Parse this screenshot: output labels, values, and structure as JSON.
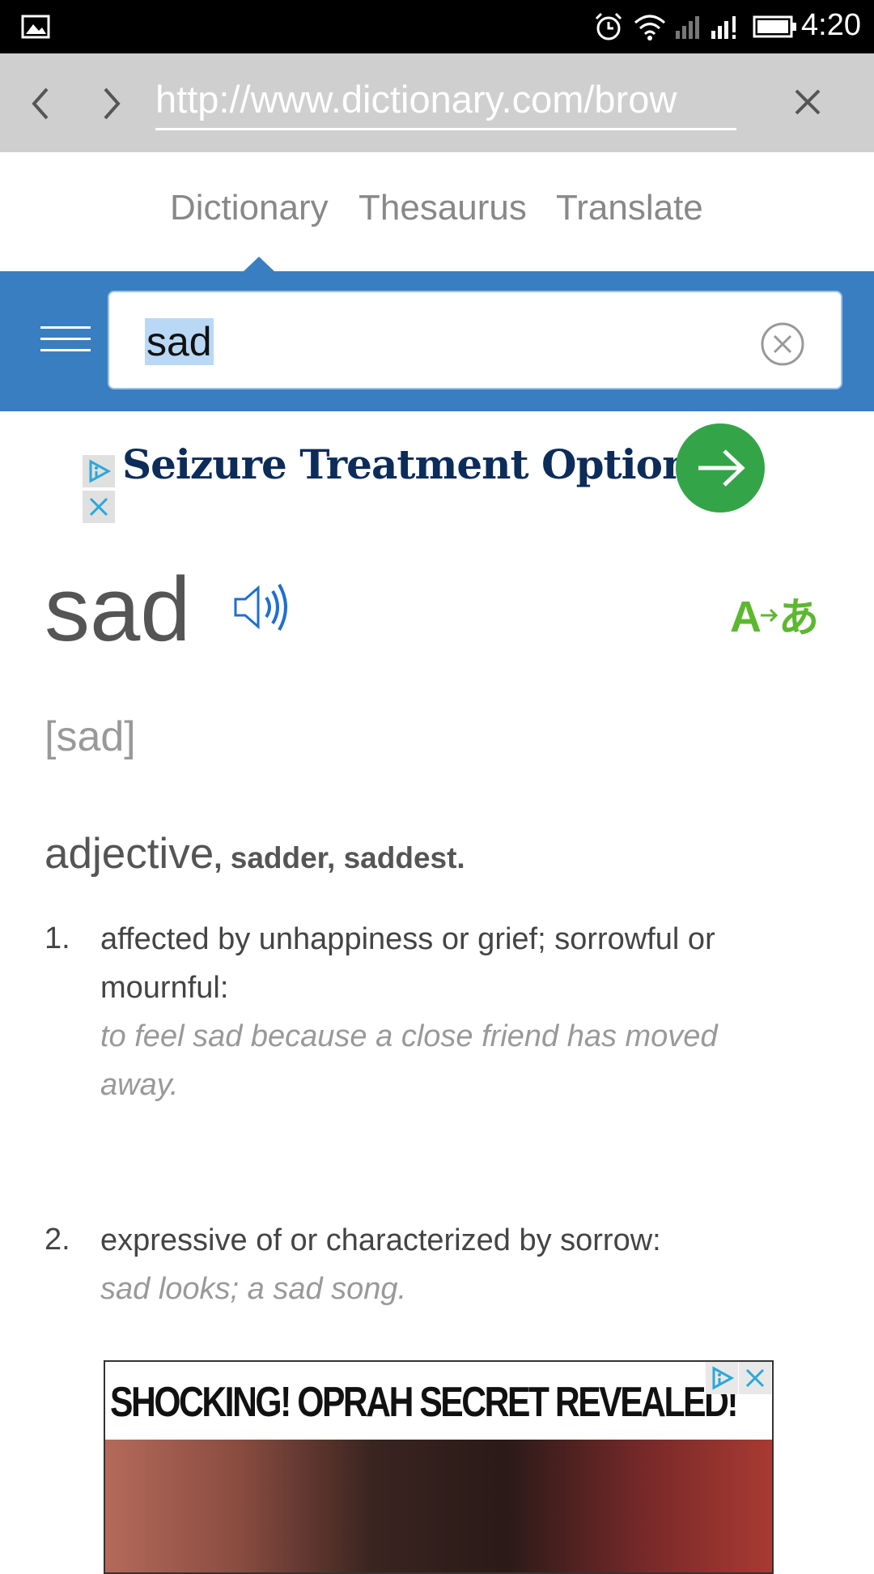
{
  "status_bar": {
    "time": "4:20",
    "icons": [
      "image-icon",
      "alarm-icon",
      "wifi-icon",
      "signal-icon",
      "signal-icon",
      "battery-icon"
    ]
  },
  "browser": {
    "url": "http://www.dictionary.com/brow"
  },
  "tabs": [
    "Dictionary",
    "Thesaurus",
    "Translate"
  ],
  "search": {
    "query": "sad"
  },
  "ad_banner": {
    "headline": "Seizure Treatment Options »"
  },
  "entry": {
    "word": "sad",
    "pronunciation": "[sad]",
    "part_of_speech": "adjective",
    "inflections": ", sadder, saddest.",
    "definitions": [
      {
        "number": "1.",
        "text": "affected by unhappiness or grief; sorrowful or mournful:",
        "example": "to feel sad because a close friend has moved away."
      },
      {
        "number": "2.",
        "text": "expressive of or characterized by sorrow:",
        "example": "sad looks; a sad song."
      }
    ]
  },
  "bottom_ad": {
    "headline": "SHOCKING! OPRAH SECRET REVEALED!"
  },
  "colors": {
    "brand_blue": "#3a7ec2",
    "ad_green": "#34a449",
    "translate_green": "#5cb82f"
  }
}
